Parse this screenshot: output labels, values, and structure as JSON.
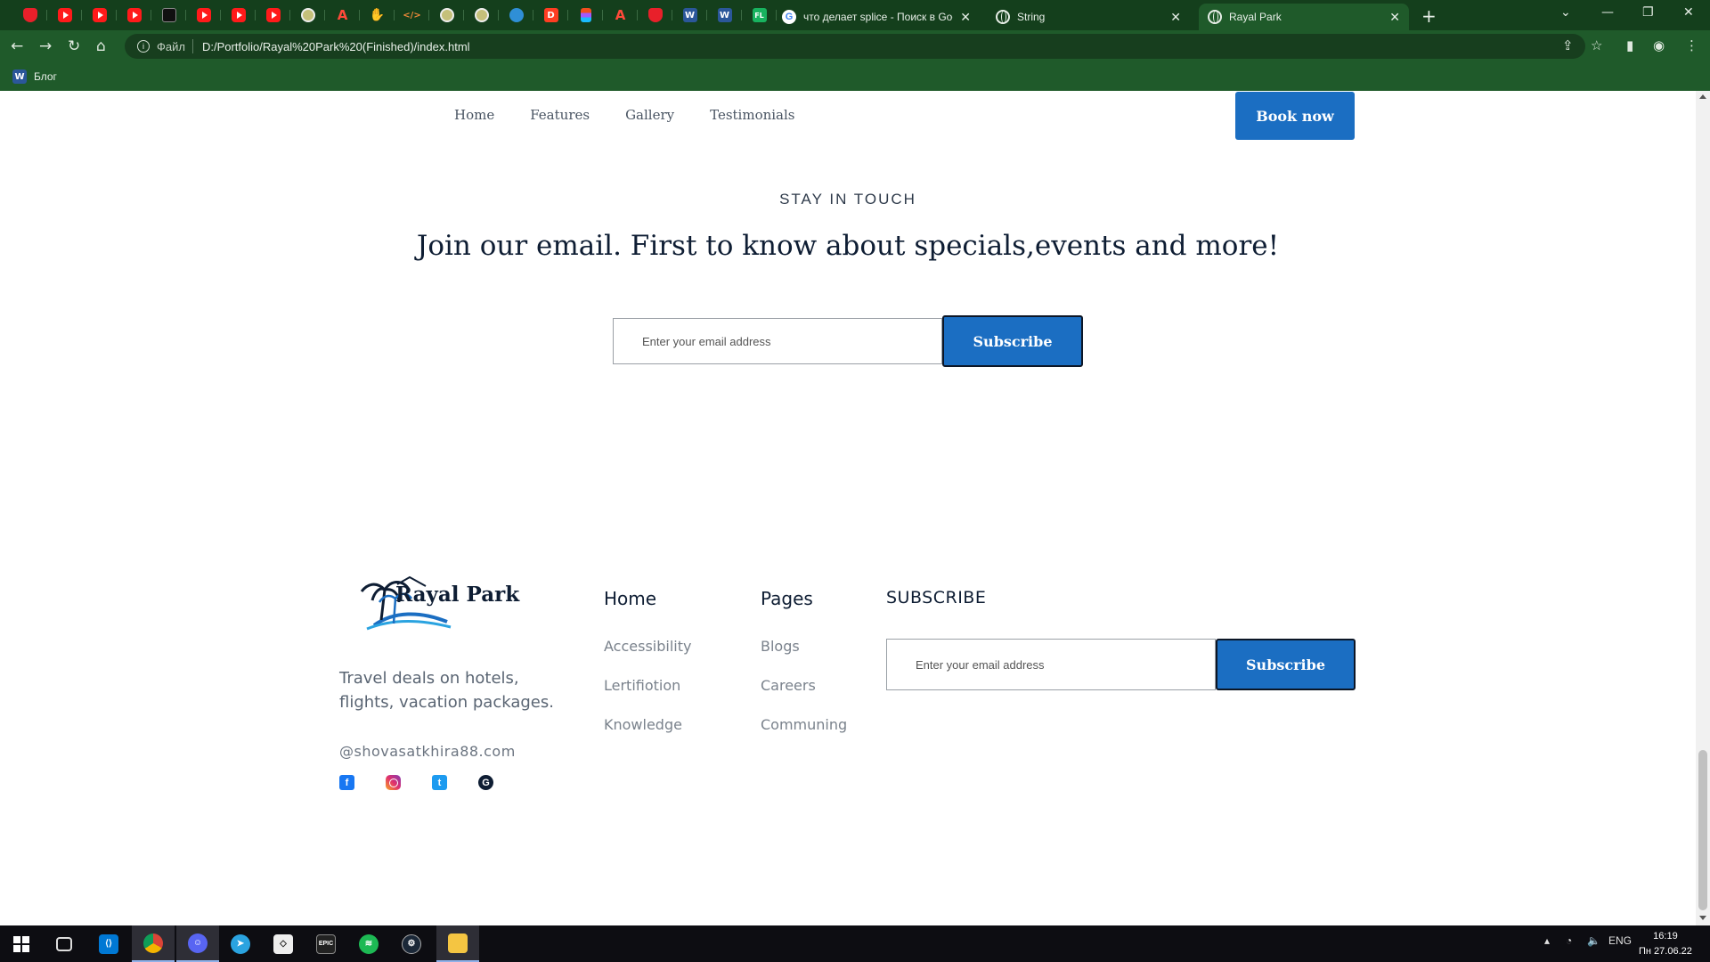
{
  "browser": {
    "pinned_tabs": [
      "shield",
      "yt",
      "yt",
      "yt",
      "dark",
      "yt",
      "yt",
      "yt",
      "round",
      "red-a",
      "hand",
      "code",
      "round",
      "round",
      "globe",
      "d",
      "figma",
      "red-a",
      "shield",
      "w",
      "w",
      "fl"
    ],
    "tabs": [
      {
        "title": "что делает splice - Поиск в Google",
        "icon": "google-icon"
      },
      {
        "title": "String",
        "icon": "globe-icon"
      },
      {
        "title": "Rayal Park",
        "icon": "globe-icon",
        "active": true
      }
    ],
    "address_scheme": "Файл",
    "address_url": "D:/Portfolio/Rayal%20Park%20(Finished)/index.html",
    "bookmark_label": "Блог"
  },
  "nav": {
    "items": [
      "Home",
      "Features",
      "Gallery",
      "Testimonials"
    ],
    "book_label": "Book now"
  },
  "hero": {
    "kicker": "STAY IN TOUCH",
    "headline": "Join our email. First to know about specials,events and more!",
    "email_placeholder": "Enter your email address",
    "subscribe_label": "Subscribe"
  },
  "footer": {
    "logo_text": "Rayal Park",
    "tagline": "Travel deals on hotels, flights, vacation packages.",
    "email": "@shovasatkhira88.com",
    "socials": [
      "facebook-icon",
      "instagram-icon",
      "twitter-icon",
      "google-icon"
    ],
    "col_home": {
      "title": "Home",
      "items": [
        "Accessibility",
        "Lertifiotion",
        "Knowledge"
      ]
    },
    "col_pages": {
      "title": "Pages",
      "items": [
        "Blogs",
        "Careers",
        "Communing"
      ]
    },
    "subscribe": {
      "title": "SUBSCRIBE",
      "email_placeholder": "Enter your email address",
      "button_label": "Subscribe"
    }
  },
  "system": {
    "lang": "ENG",
    "time": "16:19",
    "date": "Пн 27.06.22"
  },
  "colors": {
    "brand_blue": "#1b6ec2",
    "chrome_green": "#1f5a2a",
    "heading": "#0e1d33"
  }
}
